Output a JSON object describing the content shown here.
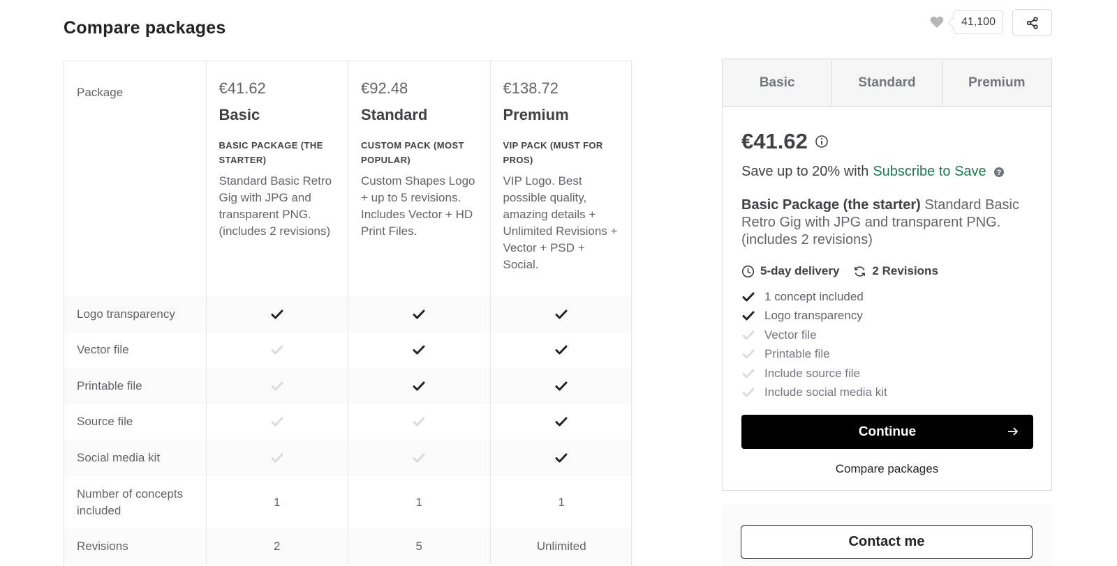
{
  "page": {
    "title": "Compare packages"
  },
  "social": {
    "favorites_count": "41,100"
  },
  "table": {
    "label_header": "Package",
    "packages": [
      {
        "price": "€41.62",
        "name": "Basic",
        "title": "BASIC PACKAGE (THE STARTER)",
        "desc": "Standard Basic Retro Gig with JPG and transparent PNG. (includes 2 revisions)"
      },
      {
        "price": "€92.48",
        "name": "Standard",
        "title": "CUSTOM PACK (MOST POPULAR)",
        "desc": "Custom Shapes Logo + up to 5 revisions. Includes Vector + HD Print Files."
      },
      {
        "price": "€138.72",
        "name": "Premium",
        "title": "VIP PACK (MUST FOR PROS)",
        "desc": "VIP Logo. Best possible quality, amazing details + Unlimited Revisions + Vector + PSD + Social."
      }
    ],
    "features": [
      {
        "label": "Logo transparency",
        "values": [
          true,
          true,
          true
        ]
      },
      {
        "label": "Vector file",
        "values": [
          false,
          true,
          true
        ]
      },
      {
        "label": "Printable file",
        "values": [
          false,
          true,
          true
        ]
      },
      {
        "label": "Source file",
        "values": [
          false,
          false,
          true
        ]
      },
      {
        "label": "Social media kit",
        "values": [
          false,
          false,
          true
        ]
      }
    ],
    "concepts": {
      "label": "Number of concepts included",
      "values": [
        "1",
        "1",
        "1"
      ]
    },
    "revisions": {
      "label": "Revisions",
      "values": [
        "2",
        "5",
        "Unlimited"
      ]
    }
  },
  "card": {
    "tabs": [
      "Basic",
      "Standard",
      "Premium"
    ],
    "active_tab": 0,
    "price": "€41.62",
    "save_prefix": "Save up to 20% with",
    "save_link": "Subscribe to Save",
    "desc_title": "Basic Package (the starter)",
    "desc": "Standard Basic Retro Gig with JPG and transparent PNG. (includes 2 revisions)",
    "delivery": "5-day delivery",
    "revisions": "2 Revisions",
    "features": [
      {
        "label": "1 concept included",
        "included": true
      },
      {
        "label": "Logo transparency",
        "included": true
      },
      {
        "label": "Vector file",
        "included": false
      },
      {
        "label": "Printable file",
        "included": false
      },
      {
        "label": "Include source file",
        "included": false
      },
      {
        "label": "Include social media kit",
        "included": false
      }
    ],
    "continue_label": "Continue",
    "compare_label": "Compare packages"
  },
  "contact": {
    "label": "Contact me"
  }
}
